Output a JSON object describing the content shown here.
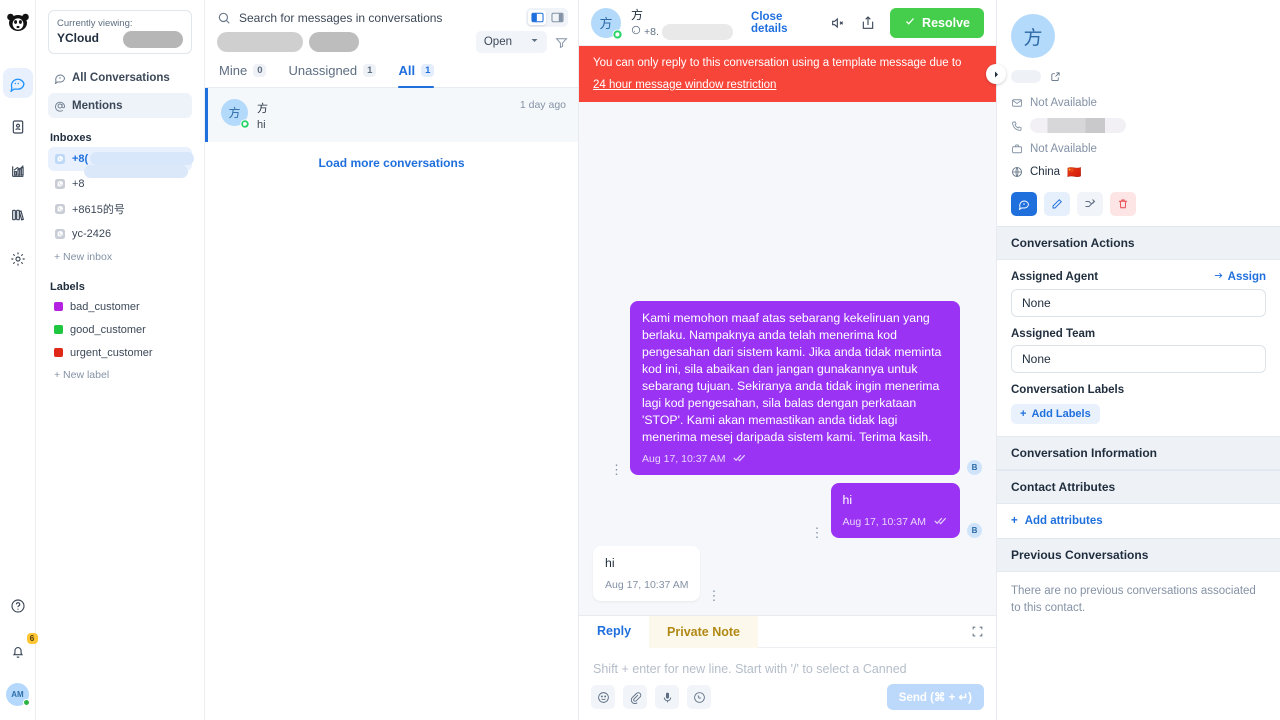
{
  "rail": {
    "logo_icon": "monkey-logo",
    "items": [
      {
        "name": "conversations",
        "icon": "chat-bubble-icon",
        "active": true
      },
      {
        "name": "contacts",
        "icon": "contact-book-icon",
        "active": false
      },
      {
        "name": "reports",
        "icon": "bar-chart-icon",
        "active": false
      },
      {
        "name": "campaigns",
        "icon": "books-icon",
        "active": false
      },
      {
        "name": "settings",
        "icon": "gear-icon",
        "active": false
      }
    ],
    "help_icon": "help-circle-icon",
    "notifications_icon": "bell-icon",
    "notifications_count": "6",
    "avatar_initials": "AM"
  },
  "sidebar": {
    "account": {
      "viewing_label": "Currently viewing:",
      "account_name": "YCloud"
    },
    "nav": [
      {
        "label": "All Conversations",
        "icon": "chat-icon",
        "selected": false
      },
      {
        "label": "Mentions",
        "icon": "at-icon",
        "selected": true
      }
    ],
    "inboxes_title": "Inboxes",
    "inboxes": [
      {
        "label": "+8(",
        "icon": "whatsapp-icon",
        "active": true
      },
      {
        "label": "+8",
        "icon": "whatsapp-icon",
        "active": false
      },
      {
        "label": "+8615的号",
        "icon": "whatsapp-icon",
        "active": false
      },
      {
        "label": "yc-2426",
        "icon": "whatsapp-icon",
        "active": false
      }
    ],
    "new_inbox_label": "+ New inbox",
    "labels_title": "Labels",
    "labels": [
      {
        "label": "bad_customer",
        "color": "#b521e0"
      },
      {
        "label": "good_customer",
        "color": "#1fc63f"
      },
      {
        "label": "urgent_customer",
        "color": "#e02718"
      }
    ],
    "new_label_label": "+ New label"
  },
  "conversation_list": {
    "search_placeholder": "Search for messages in conversations",
    "search_icon": "search-icon",
    "layout_toggle": [
      {
        "name": "expanded-layout",
        "icon": "panel-left-icon",
        "on": true
      },
      {
        "name": "condensed-layout",
        "icon": "panel-right-icon",
        "on": false
      }
    ],
    "status_filter": "Open",
    "filter_icon": "funnel-icon",
    "tabs": [
      {
        "label": "Mine",
        "count": "0",
        "active": false
      },
      {
        "label": "Unassigned",
        "count": "1",
        "active": false
      },
      {
        "label": "All",
        "count": "1",
        "active": true
      }
    ],
    "rows": [
      {
        "avatar_text": "方",
        "name": "方",
        "preview": "hi",
        "time": "1 day ago",
        "channel_icon": "whatsapp-icon"
      }
    ],
    "load_more_label": "Load more conversations"
  },
  "chat": {
    "header": {
      "avatar_text": "方",
      "name": "方",
      "channel_icon": "whatsapp-icon",
      "phone_prefix": "+8.",
      "close_details_label": "Close details",
      "mute_icon": "speaker-mute-icon",
      "share_icon": "share-box-icon",
      "resolve_label": "Resolve",
      "resolve_icon": "check-icon",
      "resolve_color": "#44ce4b"
    },
    "banner": {
      "text": "You can only reply to this conversation using a template message due to",
      "link": "24 hour message window restriction",
      "color": "#f8453a",
      "next_icon": "chevron-right-icon"
    },
    "messages": [
      {
        "direction": "out",
        "text": "Kami memohon maaf atas sebarang kekeliruan yang berlaku. Nampaknya anda telah menerima kod pengesahan dari sistem kami. Jika anda tidak meminta kod ini, sila abaikan dan jangan gunakannya untuk sebarang tujuan. Sekiranya anda tidak ingin menerima lagi kod pengesahan, sila balas dengan perkataan 'STOP'. Kami akan memastikan anda tidak lagi menerima mesej daripada sistem kami. Terima kasih.",
        "time": "Aug 17, 10:37 AM",
        "status_icon": "double-check-icon",
        "sender_badge": "B"
      },
      {
        "direction": "out",
        "text": "hi",
        "time": "Aug 17, 10:37 AM",
        "status_icon": "double-check-icon",
        "sender_badge": "B"
      },
      {
        "direction": "in",
        "text": "hi",
        "time": "Aug 17, 10:37 AM",
        "status_icon": "",
        "sender_badge": ""
      }
    ],
    "composer": {
      "tabs": [
        {
          "label": "Reply",
          "active": true
        },
        {
          "label": "Private Note",
          "active": false
        }
      ],
      "expand_icon": "expand-icon",
      "placeholder": "Shift + enter for new line. Start with '/' to select a Canned",
      "actions": [
        {
          "name": "emoji-button",
          "icon": "smiley-icon"
        },
        {
          "name": "attach-button",
          "icon": "paperclip-icon"
        },
        {
          "name": "audio-button",
          "icon": "microphone-icon"
        },
        {
          "name": "whatsapp-template-button",
          "icon": "whatsapp-icon"
        }
      ],
      "send_label": "Send (⌘ + ↵)"
    }
  },
  "right_panel": {
    "contact": {
      "avatar_text": "方",
      "external_link_icon": "external-link-icon",
      "email_icon": "envelope-icon",
      "email_value": "Not Available",
      "phone_icon": "phone-icon",
      "company_icon": "briefcase-icon",
      "company_value": "Not Available",
      "location_icon": "globe-icon",
      "location_value": "China",
      "location_flag": "🇨🇳",
      "actions": [
        {
          "name": "message-contact-button",
          "icon": "chat-icon",
          "style": "primary"
        },
        {
          "name": "edit-contact-button",
          "icon": "pencil-icon",
          "style": "light"
        },
        {
          "name": "merge-contact-button",
          "icon": "merge-icon",
          "style": "grey"
        },
        {
          "name": "delete-contact-button",
          "icon": "trash-icon",
          "style": "danger"
        }
      ]
    },
    "sections": {
      "conversation_actions": "Conversation Actions",
      "conversation_information": "Conversation Information",
      "contact_attributes": "Contact Attributes",
      "previous_conversations": "Previous Conversations"
    },
    "assigned_agent_label": "Assigned Agent",
    "assign_link_label": "Assign",
    "assigned_agent_value": "None",
    "assigned_team_label": "Assigned Team",
    "assigned_team_value": "None",
    "conversation_labels_label": "Conversation Labels",
    "add_labels_label": "Add Labels",
    "add_attributes_label": "Add attributes",
    "previous_empty_text": "There are no previous conversations associated to this contact."
  }
}
